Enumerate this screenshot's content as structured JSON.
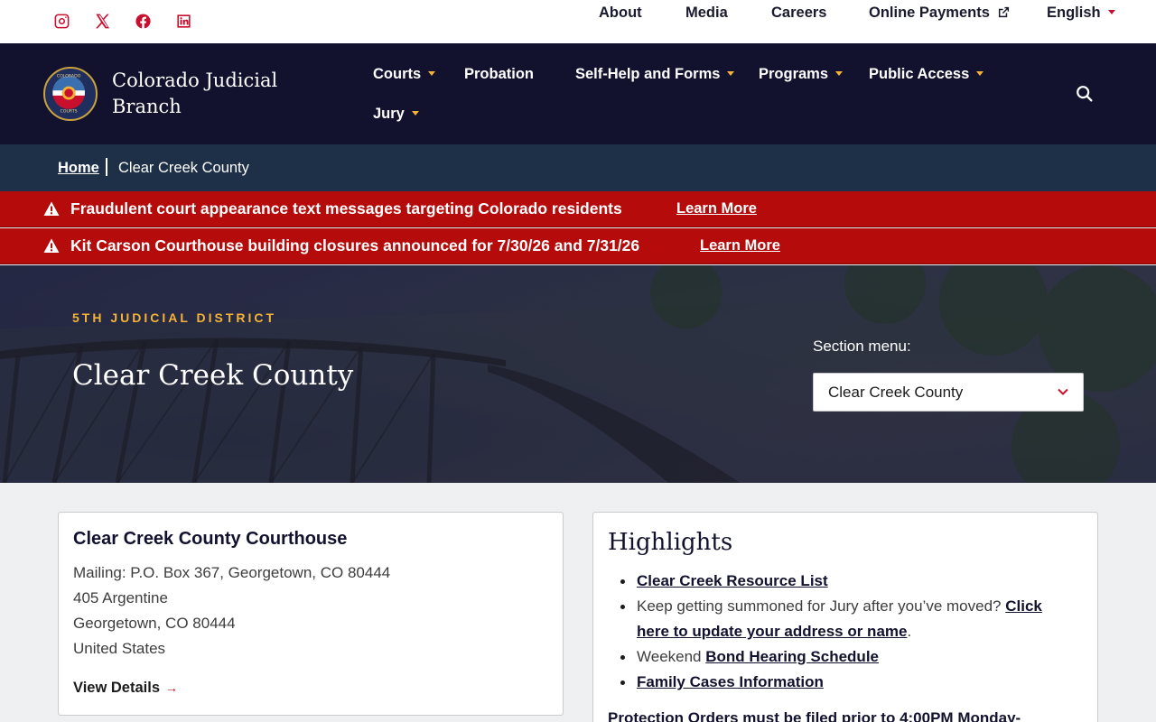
{
  "utility": {
    "social": [
      "instagram-icon",
      "x-icon",
      "facebook-icon",
      "linkedin-icon"
    ],
    "links": [
      "About",
      "Media",
      "Careers",
      "Online Payments",
      "English"
    ]
  },
  "header": {
    "brand_line1": "Colorado Judicial",
    "brand_line2": "Branch",
    "seal_text_top": "COLORADO",
    "seal_text_bottom": "COURTS",
    "nav": [
      "Courts",
      "Probation",
      "Self-Help and Forms",
      "Programs",
      "Public Access",
      "Jury"
    ]
  },
  "breadcrumb": {
    "home": "Home",
    "current": "Clear Creek County"
  },
  "alerts": [
    {
      "message": "Fraudulent court appearance text messages targeting Colorado residents",
      "link": "Learn More"
    },
    {
      "message": "Kit Carson Courthouse building closures announced for 7/30/26 and 7/31/26",
      "link": "Learn More"
    }
  ],
  "hero": {
    "district": "5TH JUDICIAL DISTRICT",
    "title": "Clear Creek County",
    "section_label": "Section menu:",
    "section_value": "Clear Creek County"
  },
  "courthouse": {
    "title": "Clear Creek County Courthouse",
    "mailing": "Mailing: P.O. Box 367, Georgetown, CO 80444",
    "street": "405 Argentine",
    "city": "Georgetown, CO 80444",
    "country": "United States",
    "view_details": "View Details"
  },
  "highlights": {
    "title": "Highlights",
    "item1_link": "Clear Creek Resource List",
    "item2_text": "Keep getting summoned for Jury after you’ve moved?",
    "item2_link_a": "Click",
    "item2_link_b": "here to update your address or name",
    "item3_text": "Weekend",
    "item3_link": "Bond Hearing Schedule",
    "item4_link": "Family Cases Information",
    "protect_link": "Protection Orders",
    "protect_text": "must be filed prior to 4:00PM Monday-"
  },
  "colors": {
    "navy": "#12122f",
    "alert_red": "#b50b0b",
    "accent_red": "#c8102e",
    "gold": "#f5b335",
    "breadcrumb_bg": "#1e3047"
  }
}
